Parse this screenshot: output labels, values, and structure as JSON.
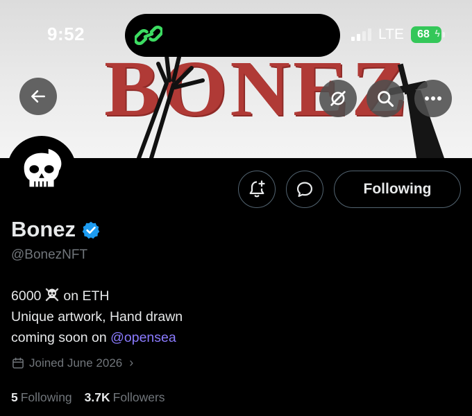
{
  "status_bar": {
    "time": "9:52",
    "network": "LTE",
    "battery": "68",
    "battery_color": "#34c759",
    "island_icon": "link-app-icon"
  },
  "banner": {
    "title": "BONEZ",
    "background": "#e6e6e6",
    "title_color": "#b03a36"
  },
  "header_buttons": {
    "back": "arrow-left-icon",
    "grok": "grok-icon",
    "search": "search-icon",
    "more": "more-icon"
  },
  "actions": {
    "notify_icon": "bell-plus-icon",
    "message_icon": "message-icon",
    "following_label": "Following"
  },
  "profile": {
    "display_name": "Bonez",
    "verified": true,
    "verified_color": "#1d9bf0",
    "handle": "@BonezNFT",
    "bio": {
      "line1_pre": "6000",
      "line1_post": "on ETH",
      "line2": "Unique artwork, Hand drawn",
      "line3_pre": "coming soon on",
      "line3_mention": "@opensea"
    },
    "joined": "Joined June 2026",
    "following_count": "5",
    "following_label": "Following",
    "followers_count": "3.7K",
    "followers_label": "Followers"
  },
  "colors": {
    "mention": "#8b7bff",
    "muted": "#71767b",
    "border": "#536471"
  }
}
